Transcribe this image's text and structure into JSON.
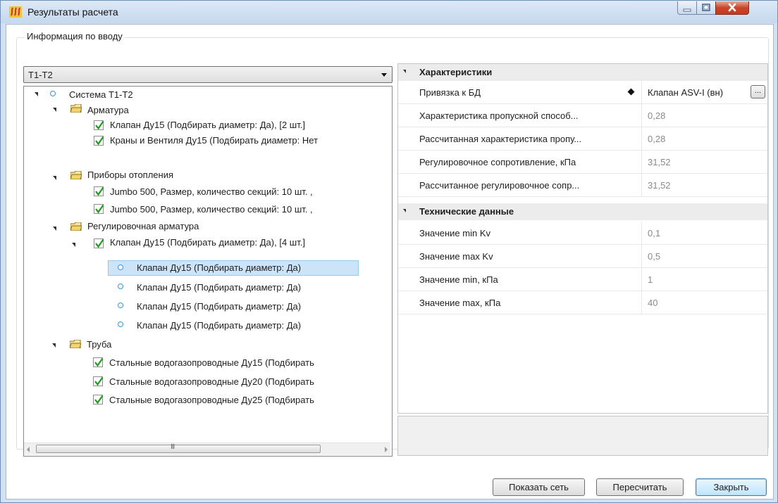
{
  "window": {
    "title": "Результаты расчета",
    "colors": {
      "title_bg": "#c6d8ee",
      "close_btn": "#c7391d",
      "selection": "#cde3f7"
    }
  },
  "group": {
    "legend": "Информация по вводу"
  },
  "combo": {
    "selected": "T1-T2"
  },
  "tree": {
    "root": "Система Т1-Т2",
    "armatura": "Арматура",
    "arm_item1": "Клапан Ду15 (Подбирать диаметр: Да), [2 шт.]",
    "arm_item2": "Краны и Вентиля Ду15 (Подбирать диаметр: Нет",
    "pribory": "Приборы отопления",
    "pri_item1": "Jumbo 500, Размер, количество секций: 10  шт. ,",
    "pri_item2": "Jumbo 500, Размер, количество секций: 10  шт. ,",
    "reg": "Регулировочная арматура",
    "reg_parent": "Клапан Ду15 (Подбирать диаметр: Да), [4 шт.]",
    "reg_child1": "Клапан Ду15 (Подбирать диаметр: Да)",
    "reg_child2": "Клапан Ду15 (Подбирать диаметр: Да)",
    "reg_child3": "Клапан Ду15 (Подбирать диаметр: Да)",
    "reg_child4": "Клапан Ду15 (Подбирать диаметр: Да)",
    "truba": "Труба",
    "tr_item1": "Стальные водогазопроводные Ду15 (Подбирать",
    "tr_item2": "Стальные водогазопроводные Ду20 (Подбирать",
    "tr_item3": "Стальные водогазопроводные Ду25 (Подбирать",
    "scroll_grip": "III"
  },
  "props": {
    "cat1": "Характеристики",
    "p1_name": "Привязка к БД",
    "p1_value": "Клапан ASV-I (вн)",
    "p1_btn": "...",
    "p2_name": "Характеристика пропускной способ...",
    "p2_value": "0,28",
    "p3_name": "Рассчитанная характеристика пропу...",
    "p3_value": "0,28",
    "p4_name": "Регулировочное сопротивление, кПа",
    "p4_value": "31,52",
    "p5_name": "Рассчитанное регулировочное сопр...",
    "p5_value": "31,52",
    "cat2": "Технические данные",
    "t1_name": "Значение min Kv",
    "t1_value": "0,1",
    "t2_name": "Значение max Kv",
    "t2_value": "0,5",
    "t3_name": "Значение min, кПа",
    "t3_value": "1",
    "t4_name": "Значение max, кПа",
    "t4_value": "40"
  },
  "buttons": {
    "show_network": "Показать сеть",
    "recalculate": "Пересчитать",
    "close": "Закрыть"
  }
}
